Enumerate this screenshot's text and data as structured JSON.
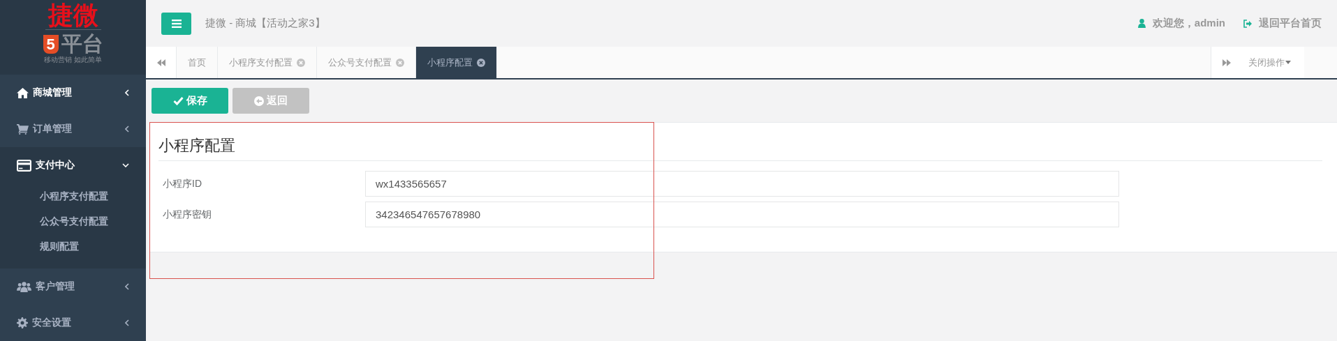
{
  "logo": {
    "title": "捷微",
    "badge": "5",
    "platform": "平台",
    "slogan": "移动营销 如此简单"
  },
  "sidebar": {
    "items": [
      {
        "label": "商城管理",
        "kind": "home",
        "selected": true,
        "expanded": false
      },
      {
        "label": "订单管理",
        "kind": "cart",
        "selected": false,
        "expanded": false
      },
      {
        "label": "支付中心",
        "kind": "card",
        "selected": true,
        "expanded": true,
        "children": [
          {
            "label": "小程序支付配置"
          },
          {
            "label": "公众号支付配置"
          },
          {
            "label": "规则配置"
          }
        ]
      },
      {
        "label": "客户管理",
        "kind": "users",
        "selected": false,
        "expanded": false
      },
      {
        "label": "安全设置",
        "kind": "gear",
        "selected": false,
        "expanded": false
      }
    ]
  },
  "header": {
    "title": "捷微 - 商城【活动之家3】",
    "user": "欢迎您，admin",
    "exit": "退回平台首页"
  },
  "tabs": [
    {
      "label": "首页",
      "selected": false,
      "closable": false
    },
    {
      "label": "小程序支付配置",
      "selected": false,
      "closable": true
    },
    {
      "label": "公众号支付配置",
      "selected": false,
      "closable": true
    },
    {
      "label": "小程序配置",
      "selected": true,
      "closable": true
    }
  ],
  "close_menu": "关闭操作",
  "toolbar": {
    "save": "保存",
    "back": "返回",
    "back_disabled": true
  },
  "form": {
    "title": "小程序配置",
    "fields": [
      {
        "label": "小程序ID",
        "value": "wx1433565657"
      },
      {
        "label": "小程序密钥",
        "value": "342346547657678980"
      }
    ]
  },
  "annotation": {
    "kind": "highlight-box",
    "color": "#d9534f"
  }
}
